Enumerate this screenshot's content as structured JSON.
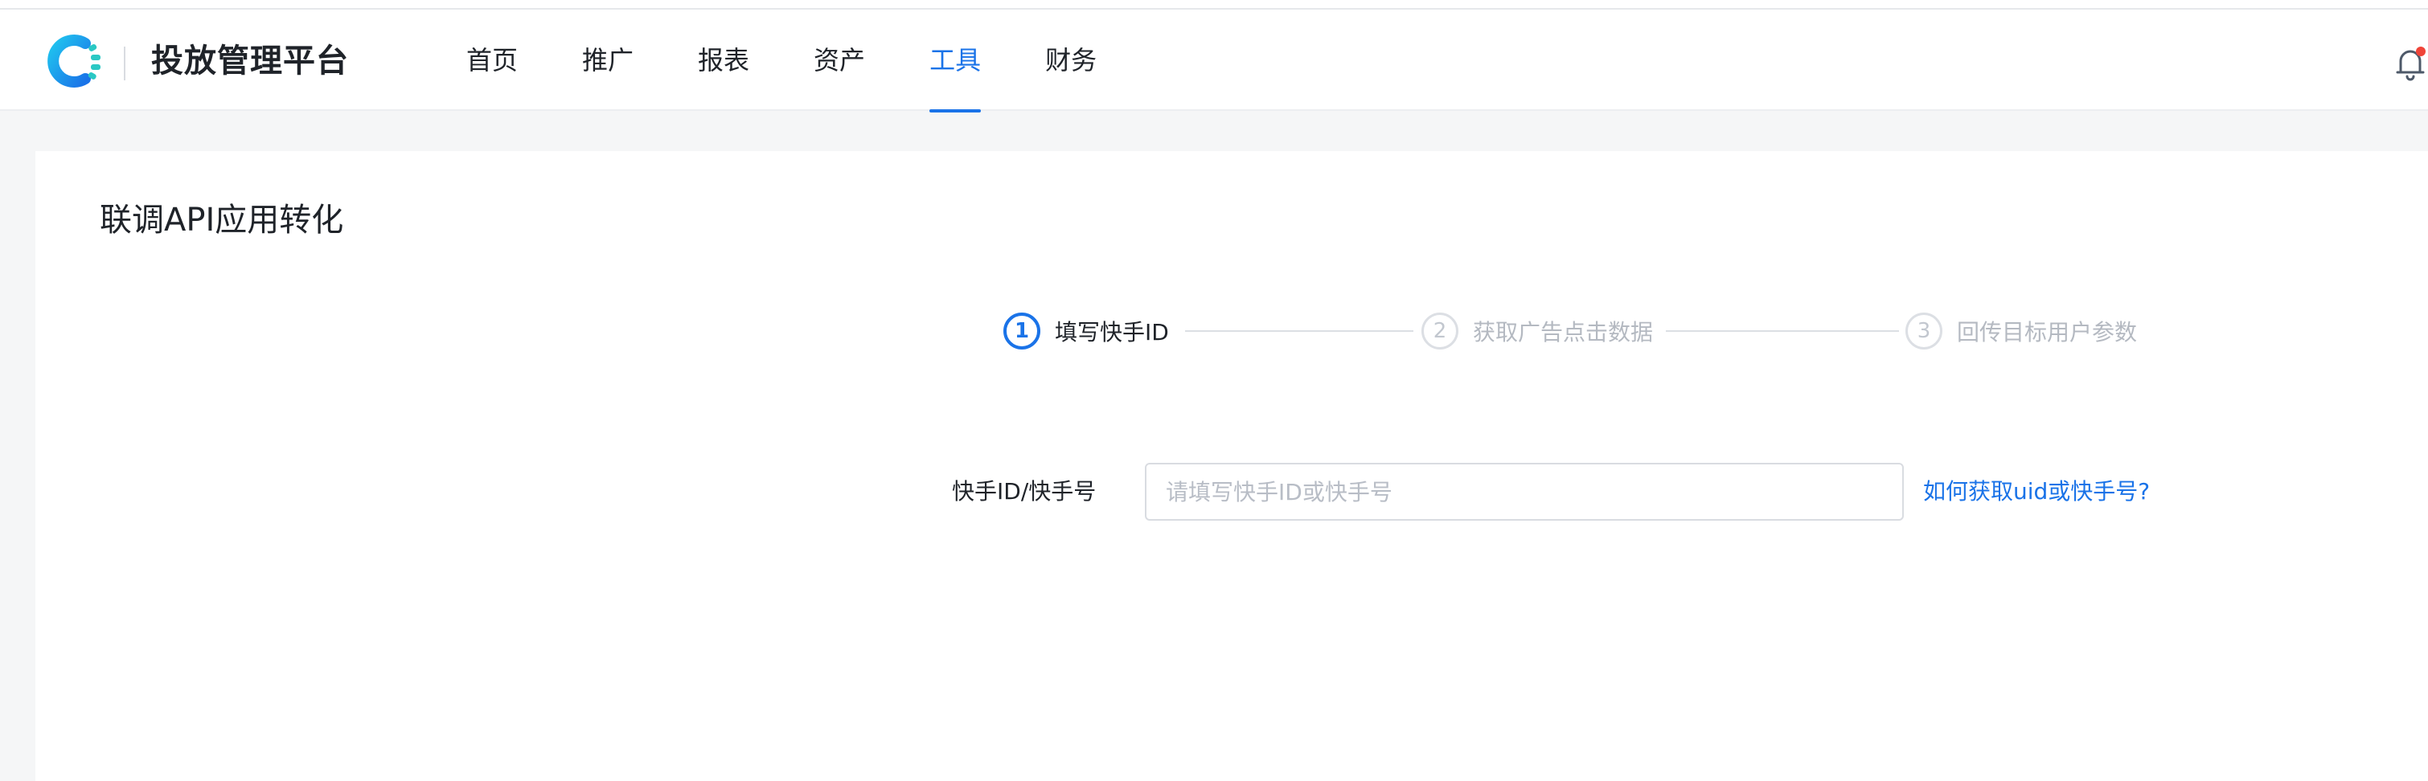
{
  "header": {
    "brand": "投放管理平台",
    "nav": [
      {
        "label": "首页"
      },
      {
        "label": "推广"
      },
      {
        "label": "报表"
      },
      {
        "label": "资产"
      },
      {
        "label": "工具",
        "active": true
      },
      {
        "label": "财务"
      }
    ],
    "icons": {
      "logo": "kuaishou-c-logo",
      "bell": "bell-icon"
    },
    "accent_color": "#1a73e8",
    "notification_dot_color": "#f04438"
  },
  "page": {
    "title": "联调API应用转化"
  },
  "steps": [
    {
      "number": "1",
      "label": "填写快手ID",
      "state": "active"
    },
    {
      "number": "2",
      "label": "获取广告点击数据",
      "state": "pending"
    },
    {
      "number": "3",
      "label": "回传目标用户参数",
      "state": "pending"
    }
  ],
  "form": {
    "label": "快手ID/快手号",
    "value": "",
    "placeholder": "请填写快手ID或快手号",
    "help_link": "如何获取uid或快手号?"
  }
}
